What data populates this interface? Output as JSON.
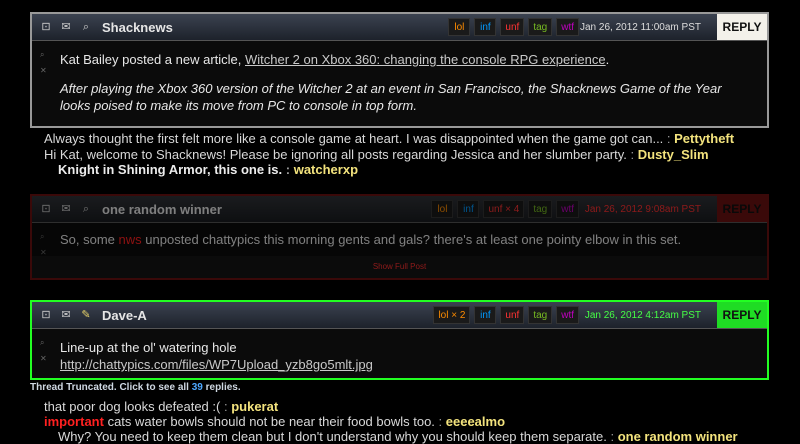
{
  "post1": {
    "author": "Shacknews",
    "tags": [
      "lol",
      "inf",
      "unf",
      "tag",
      "wtf"
    ],
    "date": "Jan 26, 2012 11:00am PST",
    "reply": "REPLY",
    "line1_prefix": "Kat Bailey posted a new article, ",
    "line1_link": "Witcher 2 on Xbox 360: changing the console RPG experience",
    "line1_suffix": ".",
    "line2": "After playing the Xbox 360 version of the Witcher 2 at an event in San Francisco, the Shacknews Game of the Year looks poised to make its move from PC to console in top form."
  },
  "replies_top": [
    {
      "text": "Always thought the first felt more like a console game at heart. I was disappointed when the game got can...",
      "sep": " : ",
      "user": "Pettytheft"
    },
    {
      "text": "Hi Kat, welcome to Shacknews! Please be ignoring all posts regarding Jessica and her slumber party.",
      "sep": " : ",
      "user": "Dusty_Slim"
    },
    {
      "text": "Knight in Shining Armor, this one is.",
      "sep": " : ",
      "user": "watcherxp"
    }
  ],
  "post2": {
    "author": "one random winner",
    "tags": [
      "lol",
      "inf",
      "unf × 4",
      "tag",
      "wtf"
    ],
    "date": "Jan 26, 2012 9:08am PST",
    "reply": "REPLY",
    "body_prefix": "So, some ",
    "body_tag": "nws",
    "body_suffix": " unposted chattypics this morning gents and gals? there's at least one pointy elbow in this set.",
    "show_full": "Show Full Post"
  },
  "post3": {
    "author": "Dave-A",
    "tags": [
      "lol × 2",
      "inf",
      "unf",
      "tag",
      "wtf"
    ],
    "date": "Jan 26, 2012 4:12am PST",
    "reply": "REPLY",
    "line1": "Line-up at the ol' watering hole",
    "link": "http://chattypics.com/files/WP7Upload_yzb8go5mlt.jpg"
  },
  "truncated": {
    "prefix": "Thread Truncated. Click to see all ",
    "count": "39",
    "suffix": " replies."
  },
  "replies_bottom": [
    {
      "prefix": "",
      "text": "that poor dog looks defeated :(",
      "sep": " : ",
      "user": "pukerat"
    },
    {
      "prefix": "important",
      "text": " cats water bowls should not be near their food bowls too.",
      "sep": " : ",
      "user": "eeeealmo"
    },
    {
      "prefix": "",
      "text": "Why? You need to keep them clean but I don't understand why you should keep them separate.",
      "sep": " : ",
      "user": "one random winner"
    }
  ],
  "colors": {
    "lol": "#ff8c00",
    "inf": "#0099ff",
    "unf": "#ff3333",
    "tag": "#77bb22",
    "wtf": "#c000c0",
    "reply_green": "#1fdc24",
    "reply_red": "#6a1111"
  }
}
